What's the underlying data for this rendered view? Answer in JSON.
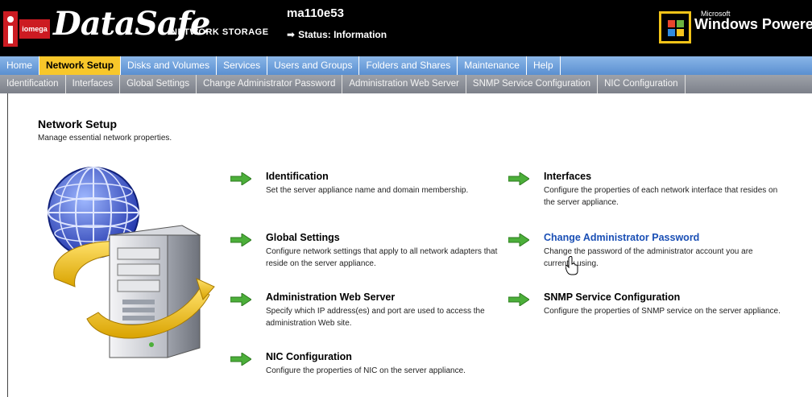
{
  "header": {
    "logo_text": "iomega",
    "brand": "DataSafe",
    "brand_sub": "NETWORK STORAGE",
    "hostname": "ma110e53",
    "status": "Status: Information",
    "windows_ms": "Microsoft",
    "windows_powered": "Windows Powered"
  },
  "nav": {
    "items": [
      {
        "label": "Home",
        "active": false
      },
      {
        "label": "Network Setup",
        "active": true
      },
      {
        "label": "Disks and Volumes",
        "active": false
      },
      {
        "label": "Services",
        "active": false
      },
      {
        "label": "Users and Groups",
        "active": false
      },
      {
        "label": "Folders and Shares",
        "active": false
      },
      {
        "label": "Maintenance",
        "active": false
      },
      {
        "label": "Help",
        "active": false
      }
    ]
  },
  "subnav": {
    "items": [
      "Identification",
      "Interfaces",
      "Global Settings",
      "Change Administrator Password",
      "Administration Web Server",
      "SNMP Service Configuration",
      "NIC Configuration"
    ]
  },
  "page": {
    "title": "Network Setup",
    "description": "Manage essential network properties."
  },
  "tasks": [
    {
      "title": "Identification",
      "description": "Set the server appliance name and domain membership.",
      "hover": false
    },
    {
      "title": "Interfaces",
      "description": "Configure the properties of each network interface that resides on the server appliance.",
      "hover": false
    },
    {
      "title": "Global Settings",
      "description": "Configure network settings that apply to all network adapters that reside on the server appliance.",
      "hover": false
    },
    {
      "title": "Change Administrator Password",
      "description": "Change the password of the administrator account you are currently using.",
      "hover": true
    },
    {
      "title": "Administration Web Server",
      "description": "Specify which IP address(es) and port are used to access the administration Web site.",
      "hover": false
    },
    {
      "title": "SNMP Service Configuration",
      "description": "Configure the properties of SNMP service on the server appliance.",
      "hover": false
    },
    {
      "title": "NIC Configuration",
      "description": "Configure the properties of NIC on the server appliance.",
      "hover": false
    }
  ],
  "colors": {
    "nav_blue": "#6d9fdc",
    "nav_active": "#f8c72a",
    "subnav_gray": "#8c9099",
    "arrow_green": "#4caf3a",
    "link_blue": "#1a4fb5",
    "brand_red": "#cc1b22"
  },
  "icons": [
    "green-arrow-icon",
    "globe-server-illustration",
    "windows-flag-icon",
    "hand-cursor-icon"
  ]
}
